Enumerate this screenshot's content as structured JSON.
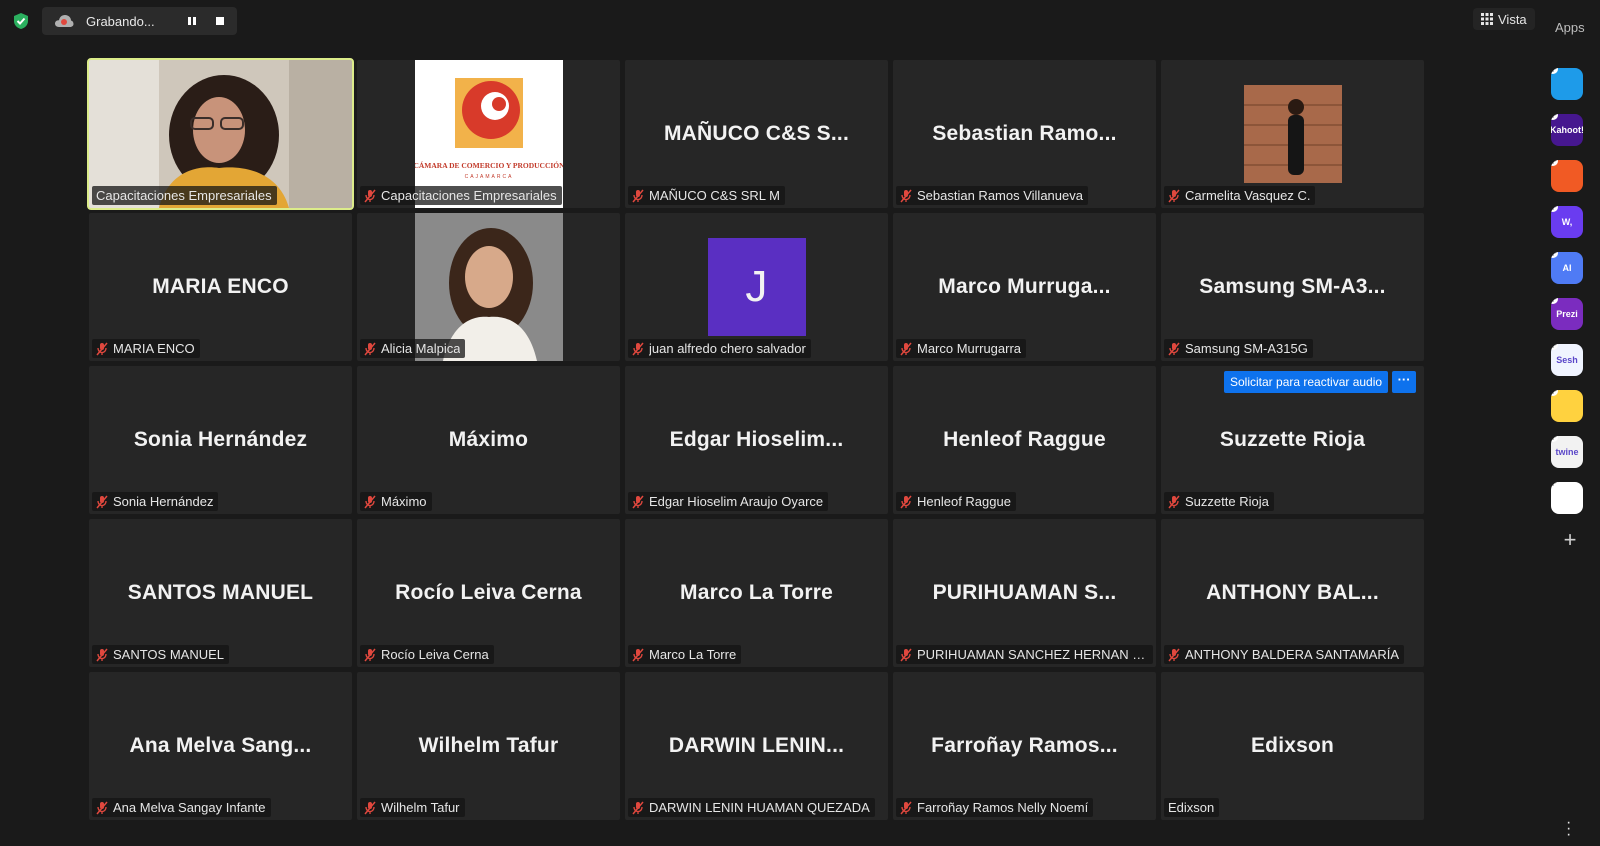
{
  "topbar": {
    "recording_label": "Grabando...",
    "view_label": "Vista",
    "apps_label": "Apps"
  },
  "colors": {
    "background": "#1a1a1a",
    "tile": "#262626",
    "active_speaker_border": "#dcec8a",
    "muted_mic": "#e0483e",
    "accent": "#0e72ed"
  },
  "unmute_request": {
    "label": "Solicitar para reactivar audio",
    "more": "···"
  },
  "participants": [
    {
      "display": "",
      "name": "Capacitaciones Empresariales",
      "muted": false,
      "media": "video",
      "active": true
    },
    {
      "display": "",
      "name": "Capacitaciones Empresariales",
      "muted": true,
      "media": "logo-camara-comercio",
      "logo_text": "CÁMARA DE COMERCIO Y PRODUCCIÓN",
      "logo_sub": "CAJAMARCA"
    },
    {
      "display": "MAÑUCO C&S S...",
      "name": "MAÑUCO C&S SRL M",
      "muted": true
    },
    {
      "display": "Sebastian  Ramo...",
      "name": "Sebastian Ramos Villanueva",
      "muted": true
    },
    {
      "display": "",
      "name": "Carmelita Vasquez C.",
      "muted": true,
      "media": "photo-carmelita"
    },
    {
      "display": "MARIA ENCO",
      "name": "MARIA ENCO",
      "muted": true
    },
    {
      "display": "",
      "name": "Alicia Malpica",
      "muted": true,
      "media": "photo-alicia"
    },
    {
      "display": "",
      "name": "juan alfredo chero salvador",
      "muted": true,
      "media": "letter-avatar",
      "avatar_letter": "J",
      "avatar_color": "#5a2fc2"
    },
    {
      "display": "Marco  Murruga...",
      "name": "Marco Murrugarra",
      "muted": true
    },
    {
      "display": "Samsung  SM-A3...",
      "name": "Samsung SM-A315G",
      "muted": true
    },
    {
      "display": "Sonia Hernández",
      "name": "Sonia Hernández",
      "muted": true
    },
    {
      "display": "Máximo",
      "name": "Máximo",
      "muted": true
    },
    {
      "display": "Edgar  Hioselim...",
      "name": "Edgar Hioselim Araujo Oyarce",
      "muted": true
    },
    {
      "display": "Henleof Raggue",
      "name": "Henleof Raggue",
      "muted": true
    },
    {
      "display": "Suzzette Rioja",
      "name": "Suzzette Rioja",
      "muted": true
    },
    {
      "display": "SANTOS MANUEL",
      "name": "SANTOS MANUEL",
      "muted": true
    },
    {
      "display": "Rocío Leiva Cerna",
      "name": "Rocío Leiva Cerna",
      "muted": true
    },
    {
      "display": "Marco La Torre",
      "name": "Marco La Torre",
      "muted": true
    },
    {
      "display": "PURIHUAMAN  S...",
      "name": "PURIHUAMAN SANCHEZ HERNAN DAV...",
      "muted": true
    },
    {
      "display": "ANTHONY  BAL...",
      "name": "ANTHONY BALDERA SANTAMARÍA",
      "muted": true
    },
    {
      "display": "Ana  Melva  Sang...",
      "name": "Ana Melva Sangay Infante",
      "muted": true
    },
    {
      "display": "Wilhelm Tafur",
      "name": "Wilhelm Tafur",
      "muted": true
    },
    {
      "display": "DARWIN  LENIN...",
      "name": "DARWIN LENIN HUAMAN QUEZADA",
      "muted": true
    },
    {
      "display": "Farroñay  Ramos...",
      "name": "Farroñay Ramos Nelly Noemí",
      "muted": true
    },
    {
      "display": "Edixson",
      "name": "Edixson",
      "muted": false
    }
  ],
  "apps": [
    {
      "icon": "app-blue-play-icon",
      "label": "",
      "color": "#1e9be9"
    },
    {
      "icon": "kahoot-icon",
      "label": "Kahoot!",
      "color": "#46178f"
    },
    {
      "icon": "app-orange-icon",
      "label": "",
      "color": "#f15a24"
    },
    {
      "icon": "wooclap-icon",
      "label": "W,",
      "color": "#6a3cf0"
    },
    {
      "icon": "ai-app-icon",
      "label": "AI",
      "color": "#4f7bf5"
    },
    {
      "icon": "prezi-icon",
      "label": "Prezi",
      "color": "#7b2cbf"
    },
    {
      "icon": "sesh-icon",
      "label": "Sesh",
      "color": "#f0f4ff"
    },
    {
      "icon": "emoji-app-icon",
      "label": "",
      "color": "#ffd23f"
    },
    {
      "icon": "twine-icon",
      "label": "twine",
      "color": "#f2f2f2"
    },
    {
      "icon": "app-grid-icon",
      "label": "",
      "color": "#ffffff"
    }
  ]
}
